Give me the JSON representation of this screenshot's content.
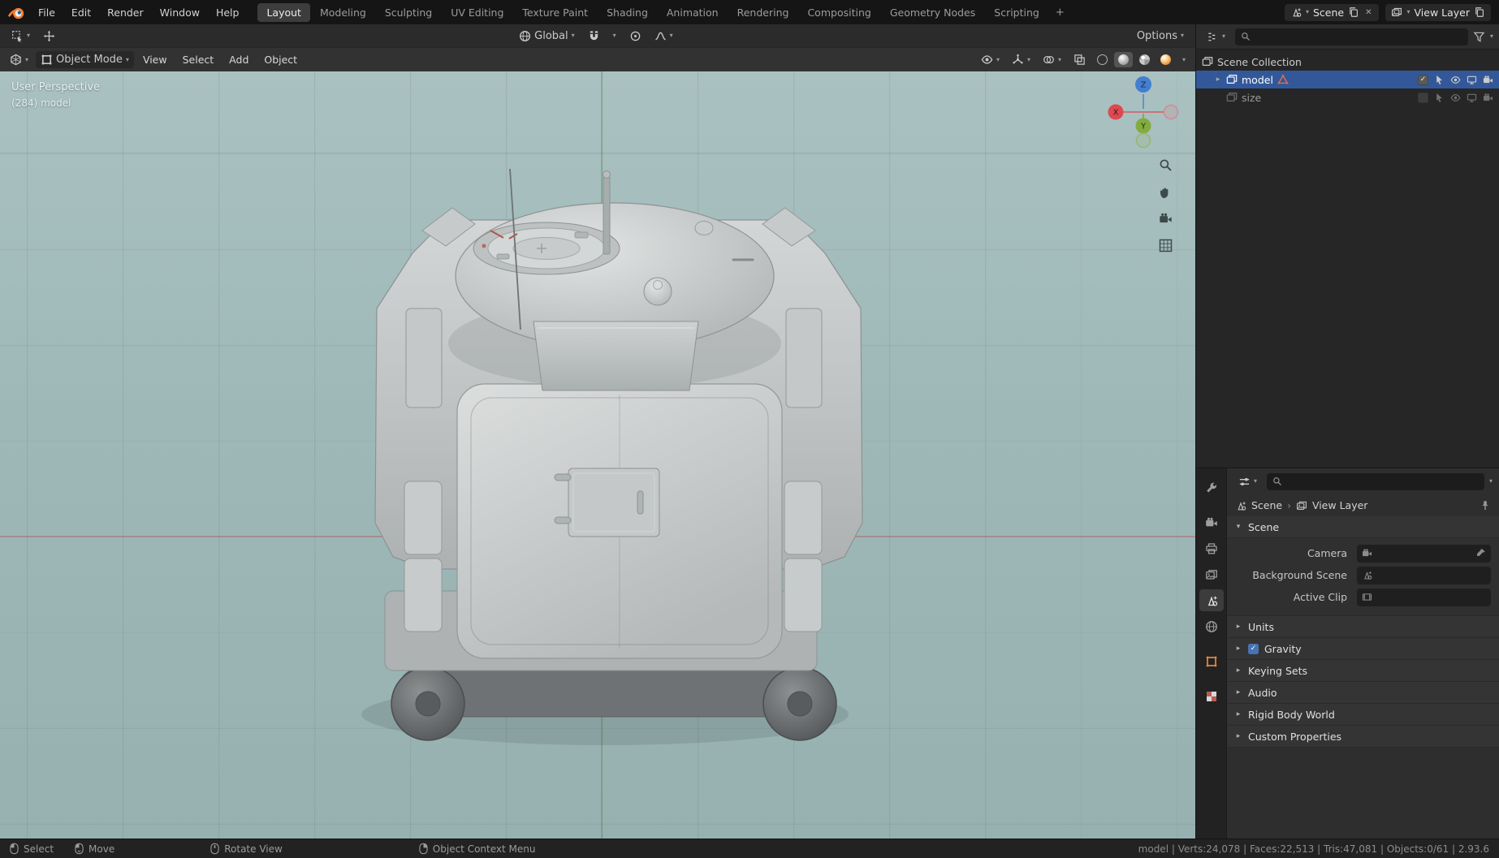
{
  "topbar": {
    "menus": [
      "File",
      "Edit",
      "Render",
      "Window",
      "Help"
    ],
    "workspaces": [
      "Layout",
      "Modeling",
      "Sculpting",
      "UV Editing",
      "Texture Paint",
      "Shading",
      "Animation",
      "Rendering",
      "Compositing",
      "Geometry Nodes",
      "Scripting"
    ],
    "active_workspace": "Layout",
    "add_tab": "+",
    "scene": "Scene",
    "view_layer": "View Layer"
  },
  "toolbar": {
    "orientation": "Global",
    "options": "Options"
  },
  "viewport": {
    "mode": "Object Mode",
    "menus": [
      "View",
      "Select",
      "Add",
      "Object"
    ],
    "overlay_line1": "User Perspective",
    "overlay_line2": "(284) model",
    "gizmo": {
      "x": "X",
      "y": "Y",
      "z": "Z"
    }
  },
  "outliner": {
    "rows": [
      {
        "label": "Scene Collection"
      },
      {
        "label": "model"
      },
      {
        "label": "size"
      }
    ]
  },
  "properties": {
    "breadcrumb_scene": "Scene",
    "breadcrumb_view_layer": "View Layer",
    "scene_panel": {
      "title": "Scene",
      "camera_label": "Camera",
      "background_label": "Background Scene",
      "clip_label": "Active Clip"
    },
    "collapsed_panels": [
      "Units",
      "Gravity",
      "Keying Sets",
      "Audio",
      "Rigid Body World",
      "Custom Properties"
    ]
  },
  "statusbar": {
    "hints": [
      "Select",
      "Move",
      "Rotate View",
      "Object Context Menu"
    ],
    "stats": "model | Verts:24,078 | Faces:22,513 | Tris:47,081 | Objects:0/61 | 2.93.6"
  },
  "glyphs": {
    "chevron": "▾",
    "arrow_open": "▾",
    "arrow_closed": "▸",
    "sep": "›",
    "check": "✓",
    "close": "✕"
  },
  "colors": {
    "accent": "#4772b3",
    "selection": "#33589a",
    "viewport_bg": "#9eb8b8",
    "object_tab_orange": "#e8883a",
    "axis_x": "#dd4950",
    "axis_y": "#83ac40",
    "axis_z": "#437fd0"
  }
}
